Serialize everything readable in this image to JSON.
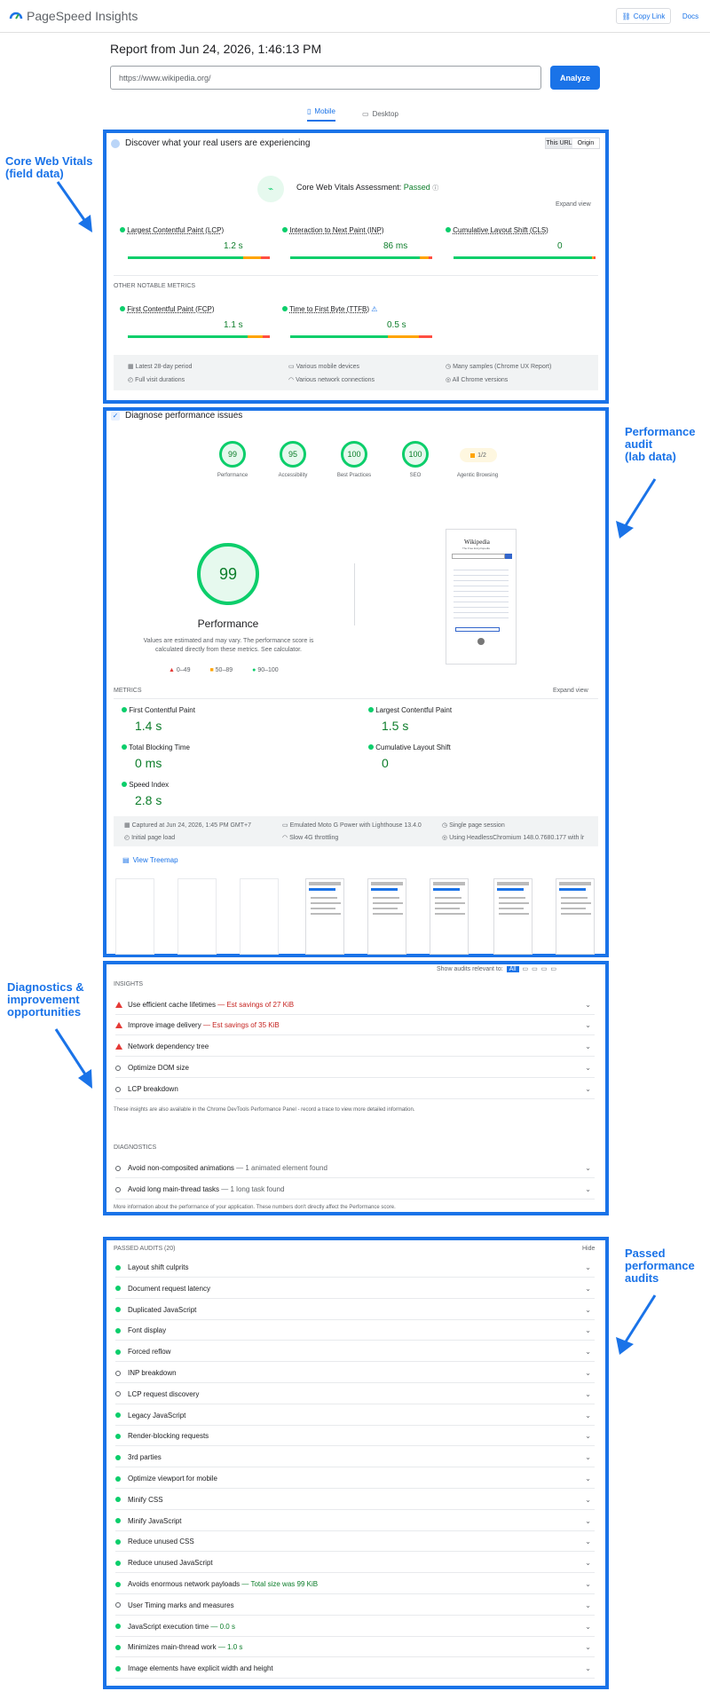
{
  "header": {
    "brand": "PageSpeed Insights",
    "copy_link": "Copy Link",
    "docs": "Docs"
  },
  "report": {
    "title": "Report from Jun 24, 2026, 1:46:13 PM",
    "url": "https://www.wikipedia.org/",
    "analyze": "Analyze"
  },
  "tabs": {
    "mobile": "Mobile",
    "desktop": "Desktop"
  },
  "callouts": {
    "cwv": "Core Web Vitals\n(field data)",
    "perf": "Performance\naudit\n(lab data)",
    "diag": "Diagnostics &\nimprovement\nopportunities",
    "passed": "Passed\nperformance\naudits"
  },
  "field": {
    "heading": "Discover what your real users are experiencing",
    "toggle_url": "This URL",
    "toggle_origin": "Origin",
    "assessment_label": "Core Web Vitals Assessment:",
    "assessment_value": "Passed",
    "expand": "Expand view",
    "metrics": [
      {
        "name": "Largest Contentful Paint (LCP)",
        "value": "1.2 s"
      },
      {
        "name": "Interaction to Next Paint (INP)",
        "value": "86 ms"
      },
      {
        "name": "Cumulative Layout Shift (CLS)",
        "value": "0"
      }
    ],
    "other_heading": "OTHER NOTABLE METRICS",
    "other": [
      {
        "name": "First Contentful Paint (FCP)",
        "value": "1.1 s"
      },
      {
        "name": "Time to First Byte (TTFB)",
        "value": "0.5 s"
      }
    ],
    "footer": [
      "Latest 28-day period",
      "Various mobile devices",
      "Many samples (Chrome UX Report)",
      "Full visit durations",
      "Various network connections",
      "All Chrome versions"
    ]
  },
  "lab": {
    "heading": "Diagnose performance issues",
    "scores": [
      {
        "label": "Performance",
        "value": "99"
      },
      {
        "label": "Accessibility",
        "value": "95"
      },
      {
        "label": "Best Practices",
        "value": "100"
      },
      {
        "label": "SEO",
        "value": "100"
      },
      {
        "label": "Agentic Browsing",
        "value": "1/2"
      }
    ],
    "big_score": "99",
    "big_label": "Performance",
    "note": "Values are estimated and may vary. The performance score is calculated directly from these metrics. See calculator.",
    "legend": [
      "0–49",
      "50–89",
      "90–100"
    ],
    "metrics_heading": "METRICS",
    "expand": "Expand view",
    "metrics": [
      {
        "name": "First Contentful Paint",
        "value": "1.4 s"
      },
      {
        "name": "Largest Contentful Paint",
        "value": "1.5 s"
      },
      {
        "name": "Total Blocking Time",
        "value": "0 ms"
      },
      {
        "name": "Cumulative Layout Shift",
        "value": "0"
      },
      {
        "name": "Speed Index",
        "value": "2.8 s"
      }
    ],
    "footer": [
      "Captured at Jun 24, 2026, 1:45 PM GMT+7",
      "Emulated Moto G Power with Lighthouse 13.4.0",
      "Single page session",
      "Initial page load",
      "Slow 4G throttling",
      "Using HeadlessChromium 148.0.7680.177 with lr"
    ],
    "treemap": "View Treemap",
    "screenshot_brand": "Wikipedia",
    "screenshot_tagline": "The Free Encyclopedia"
  },
  "insights": {
    "filter_label": "Show audits relevant to:",
    "filter_all": "All",
    "heading": "INSIGHTS",
    "items": [
      {
        "text": "Use efficient cache lifetimes",
        "extra": "— Est savings of 27 KiB",
        "status": "fail"
      },
      {
        "text": "Improve image delivery",
        "extra": "— Est savings of 35 KiB",
        "status": "fail"
      },
      {
        "text": "Network dependency tree",
        "extra": "",
        "status": "fail"
      },
      {
        "text": "Optimize DOM size",
        "extra": "",
        "status": "info"
      },
      {
        "text": "LCP breakdown",
        "extra": "",
        "status": "info"
      }
    ],
    "note": "These insights are also available in the Chrome DevTools Performance Panel - record a trace to view more detailed information.",
    "diag_heading": "DIAGNOSTICS",
    "diag": [
      {
        "text": "Avoid non-composited animations",
        "extra": "— 1 animated element found"
      },
      {
        "text": "Avoid long main-thread tasks",
        "extra": "— 1 long task found"
      }
    ],
    "diag_note": "More information about the performance of your application. These numbers don't directly affect the Performance score."
  },
  "passed": {
    "heading": "PASSED AUDITS (20)",
    "hide": "Hide",
    "items": [
      {
        "text": "Layout shift culprits",
        "extra": "",
        "status": "pass"
      },
      {
        "text": "Document request latency",
        "extra": "",
        "status": "pass"
      },
      {
        "text": "Duplicated JavaScript",
        "extra": "",
        "status": "pass"
      },
      {
        "text": "Font display",
        "extra": "",
        "status": "pass"
      },
      {
        "text": "Forced reflow",
        "extra": "",
        "status": "pass"
      },
      {
        "text": "INP breakdown",
        "extra": "",
        "status": "info"
      },
      {
        "text": "LCP request discovery",
        "extra": "",
        "status": "info"
      },
      {
        "text": "Legacy JavaScript",
        "extra": "",
        "status": "pass"
      },
      {
        "text": "Render-blocking requests",
        "extra": "",
        "status": "pass"
      },
      {
        "text": "3rd parties",
        "extra": "",
        "status": "pass"
      },
      {
        "text": "Optimize viewport for mobile",
        "extra": "",
        "status": "pass"
      },
      {
        "text": "Minify CSS",
        "extra": "",
        "status": "pass"
      },
      {
        "text": "Minify JavaScript",
        "extra": "",
        "status": "pass"
      },
      {
        "text": "Reduce unused CSS",
        "extra": "",
        "status": "pass"
      },
      {
        "text": "Reduce unused JavaScript",
        "extra": "",
        "status": "pass"
      },
      {
        "text": "Avoids enormous network payloads",
        "extra": "— Total size was 99 KiB",
        "status": "pass"
      },
      {
        "text": "User Timing marks and measures",
        "extra": "",
        "status": "info"
      },
      {
        "text": "JavaScript execution time",
        "extra": "— 0.0 s",
        "status": "pass"
      },
      {
        "text": "Minimizes main-thread work",
        "extra": "— 1.0 s",
        "status": "pass"
      },
      {
        "text": "Image elements have explicit width and height",
        "extra": "",
        "status": "pass"
      }
    ]
  }
}
